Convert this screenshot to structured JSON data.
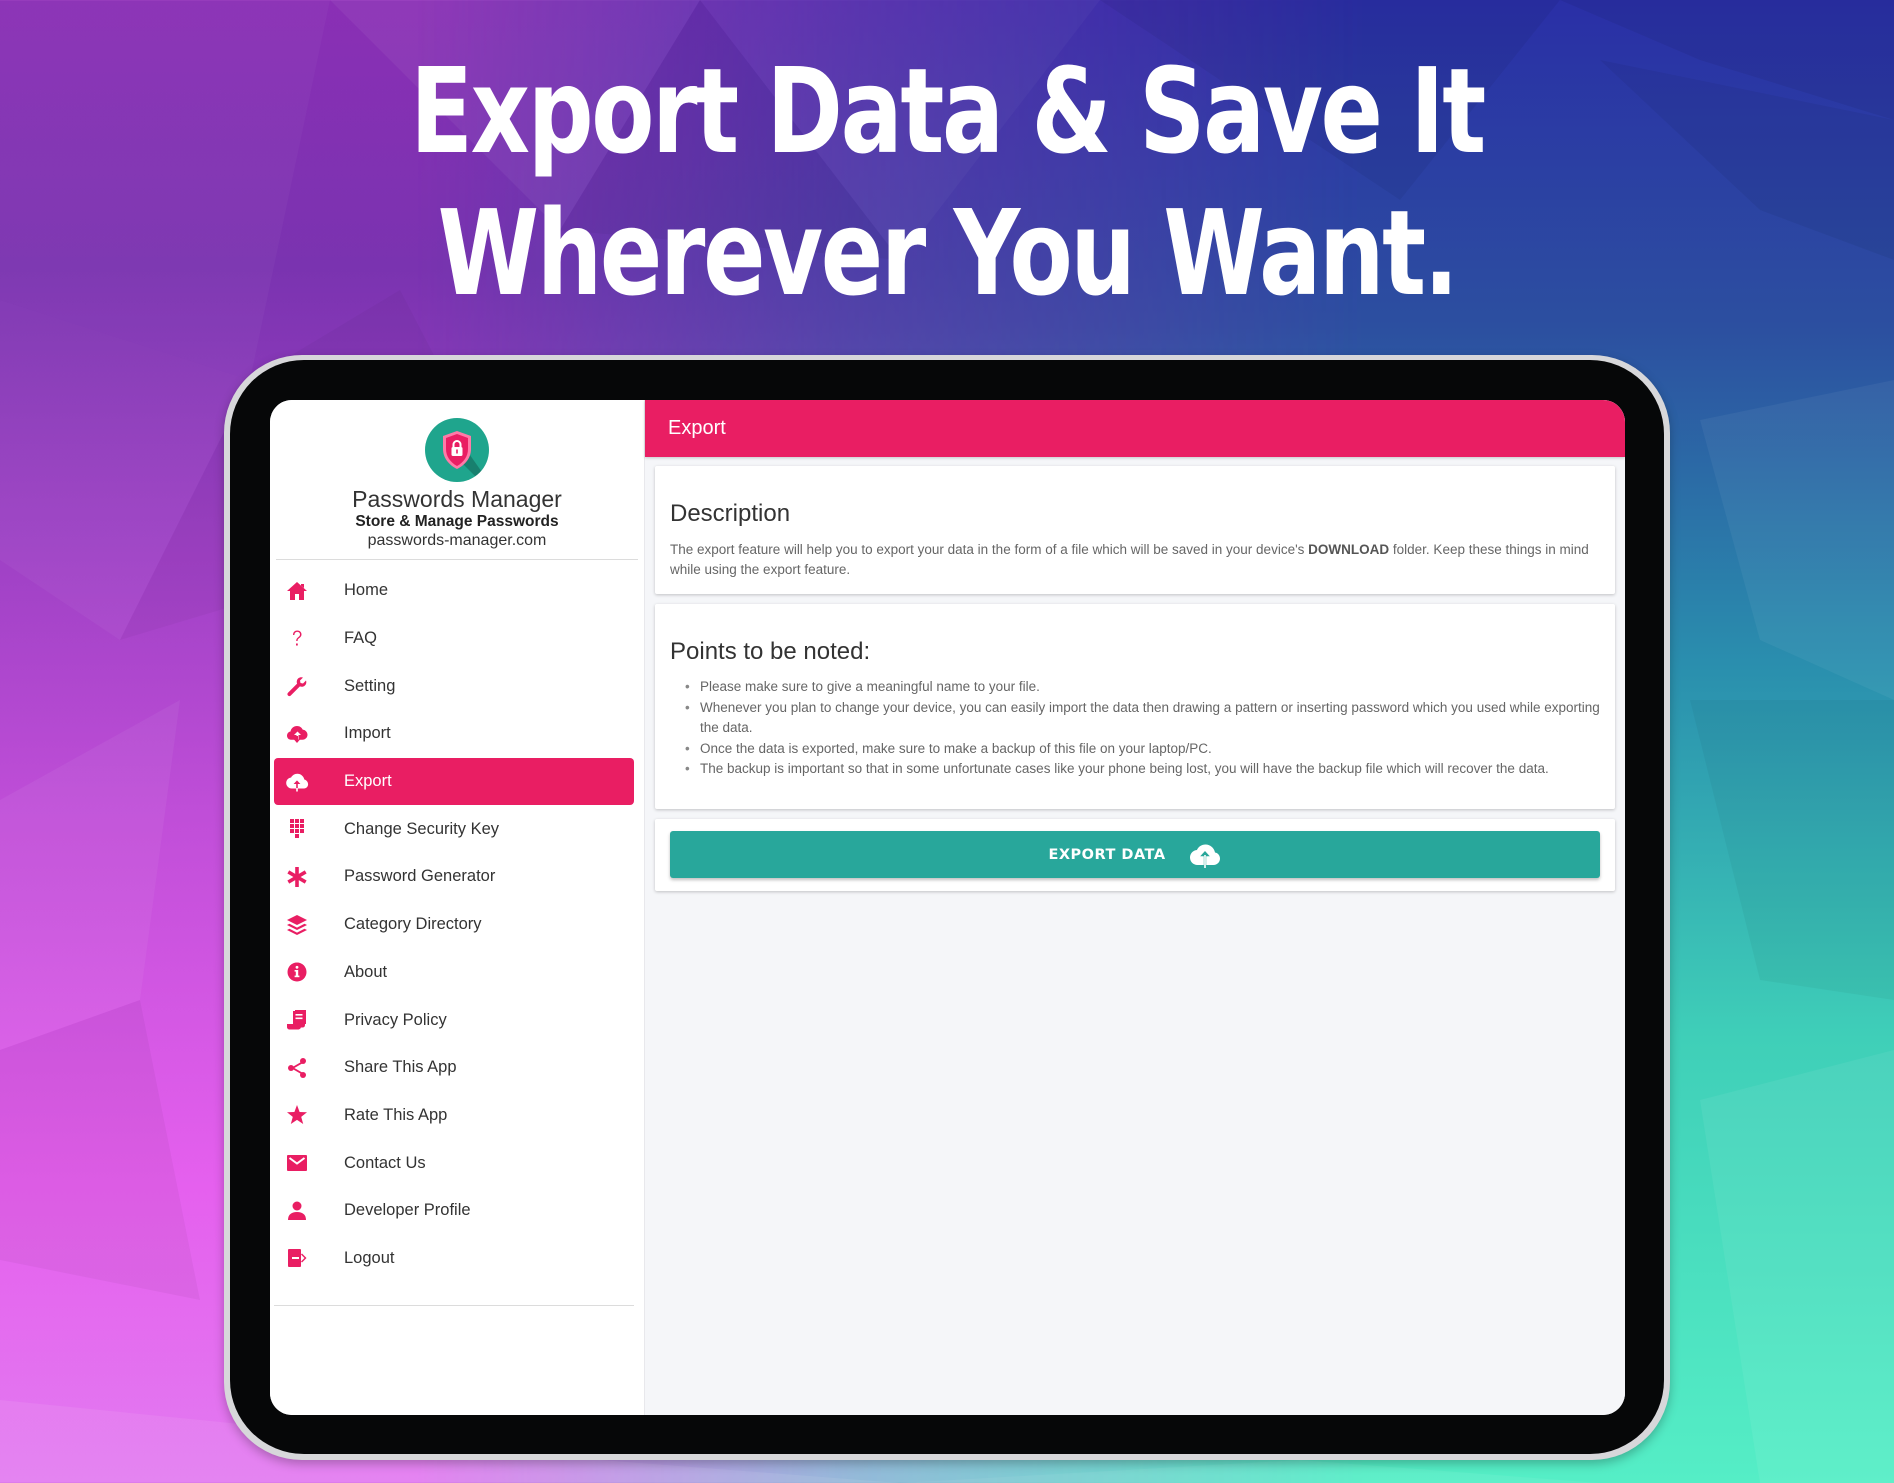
{
  "promo": {
    "headline_line1": "Export Data & Save It",
    "headline_line2": "Wherever You Want."
  },
  "colors": {
    "accent": "#E91E63",
    "button": "#28A79B",
    "logo_bg": "#1FA58D"
  },
  "app": {
    "brand_name": "Passwords Manager",
    "tagline": "Store & Manage Passwords",
    "website": "passwords-manager.com",
    "logo_icon": "shield-lock-icon"
  },
  "sidebar": {
    "active_item": "Export",
    "items": [
      {
        "label": "Home",
        "icon": "home-icon"
      },
      {
        "label": "FAQ",
        "icon": "question-icon"
      },
      {
        "label": "Setting",
        "icon": "wrench-icon"
      },
      {
        "label": "Import",
        "icon": "cloud-download-icon"
      },
      {
        "label": "Export",
        "icon": "cloud-upload-icon"
      },
      {
        "label": "Change Security Key",
        "icon": "keypad-icon"
      },
      {
        "label": "Password Generator",
        "icon": "asterisk-icon"
      },
      {
        "label": "Category Directory",
        "icon": "layers-icon"
      },
      {
        "label": "About",
        "icon": "info-icon"
      },
      {
        "label": "Privacy Policy",
        "icon": "document-icon"
      },
      {
        "label": "Share This App",
        "icon": "share-icon"
      },
      {
        "label": "Rate This App",
        "icon": "star-icon"
      },
      {
        "label": "Contact Us",
        "icon": "envelope-icon"
      },
      {
        "label": "Developer Profile",
        "icon": "user-icon"
      },
      {
        "label": "Logout",
        "icon": "logout-icon"
      }
    ]
  },
  "header": {
    "title": "Export"
  },
  "description": {
    "title": "Description",
    "text_before": "The export feature will help you to export your data in the form of a file which will be saved in your device's ",
    "text_bold": "DOWNLOAD",
    "text_after": " folder. Keep these things in mind while using the export feature."
  },
  "points": {
    "title": "Points to be noted:",
    "items": [
      "Please make sure to give a meaningful name to your file.",
      "Whenever you plan to change your device, you can easily import the data then drawing a pattern or inserting password which you used while exporting the data.",
      "Once the data is exported, make sure to make a backup of this file on your laptop/PC.",
      "The backup is important so that in some unfortunate cases like your phone being lost, you will have the backup file which will recover the data."
    ]
  },
  "action": {
    "export_label": "EXPORT DATA",
    "export_icon": "cloud-upload-icon"
  }
}
